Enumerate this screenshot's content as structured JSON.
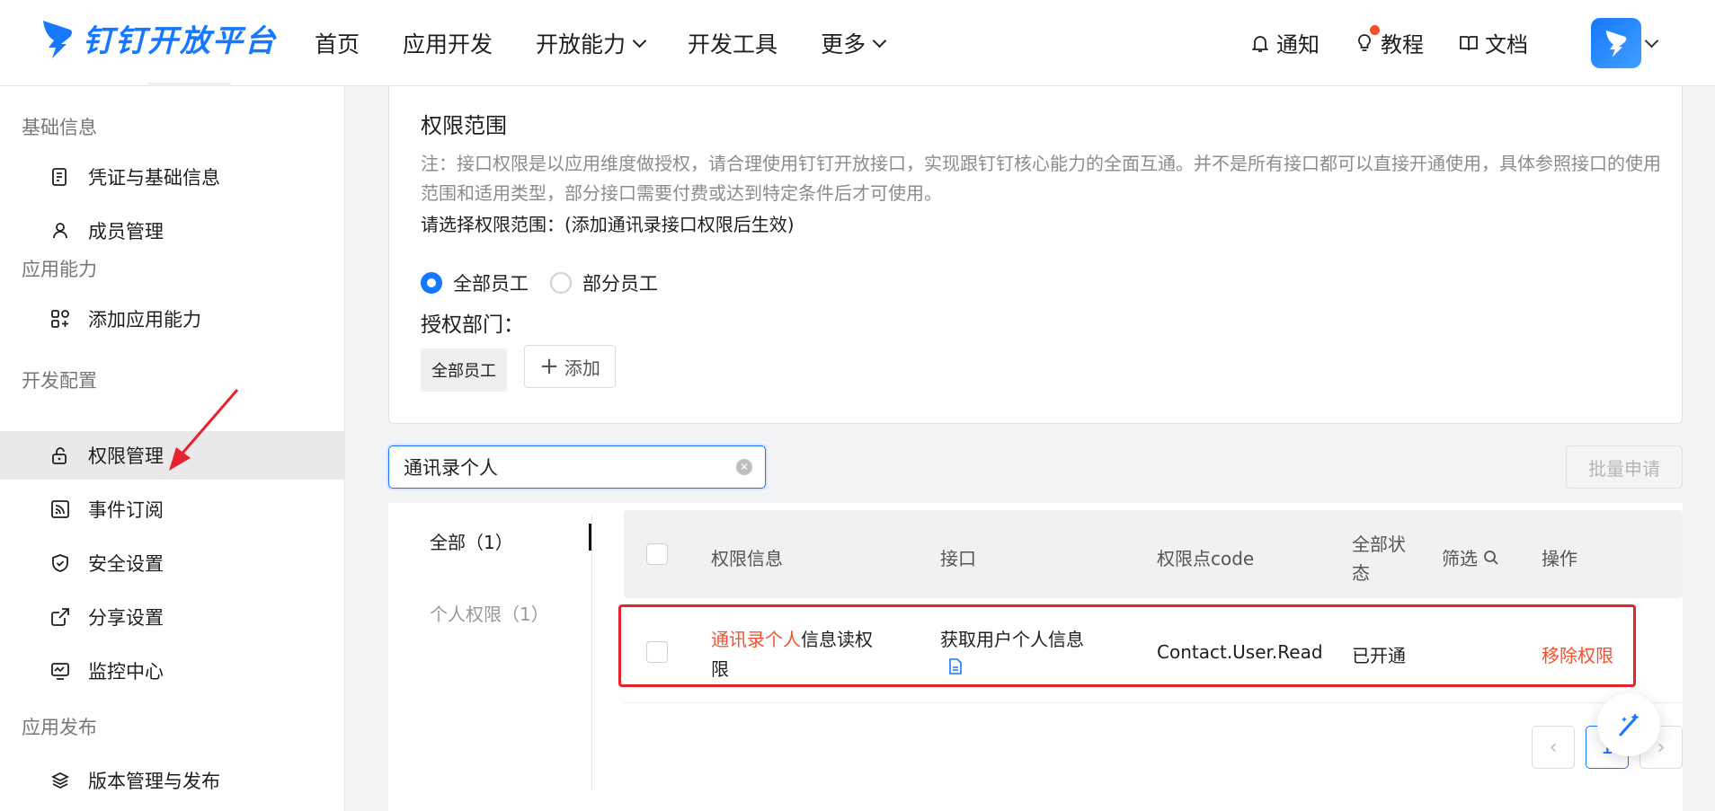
{
  "colors": {
    "accent": "#1677ff",
    "danger": "#f5502c",
    "highlight_box": "#e4232e"
  },
  "header": {
    "brand": "钉钉开放平台",
    "nav": [
      "首页",
      "应用开发",
      "开放能力",
      "开发工具",
      "更多"
    ],
    "right": {
      "notify": "通知",
      "tutorial": "教程",
      "docs": "文档"
    }
  },
  "sidebar": {
    "groups": [
      {
        "label": "基础信息",
        "items": [
          "凭证与基础信息",
          "成员管理"
        ]
      },
      {
        "label": "应用能力",
        "items": [
          "添加应用能力"
        ]
      },
      {
        "label": "开发配置",
        "items": [
          "权限管理",
          "事件订阅",
          "安全设置",
          "分享设置",
          "监控中心"
        ]
      },
      {
        "label": "应用发布",
        "items": [
          "版本管理与发布"
        ]
      }
    ],
    "active": "权限管理"
  },
  "scope": {
    "title": "权限范围",
    "note": "注：接口权限是以应用维度做授权，请合理使用钉钉开放接口，实现跟钉钉核心能力的全面互通。并不是所有接口都可以直接开通使用，具体参照接口的使用范围和适用类型，部分接口需要付费或达到特定条件后才可使用。",
    "prompt": "请选择权限范围：(添加通讯录接口权限后生效)",
    "radio_all": "全部员工",
    "radio_partial": "部分员工",
    "selected": "全部员工",
    "dept_label": "授权部门：",
    "dept_tag": "全部员工",
    "add_label": "添加"
  },
  "search": {
    "value": "通讯录个人"
  },
  "batch_apply": "批量申请",
  "filters": {
    "all": "全部（1）",
    "personal": "个人权限（1）"
  },
  "table": {
    "headers": {
      "info": "权限信息",
      "api": "接口",
      "code": "权限点code",
      "status": "全部状态",
      "filter": "筛选",
      "action": "操作"
    },
    "rows": [
      {
        "info_highlight": "通讯录个人",
        "info_rest": "信息读权限",
        "api": "获取用户个人信息",
        "code": "Contact.User.Read",
        "status": "已开通",
        "action": "移除权限"
      }
    ]
  },
  "pagination": {
    "current": "1"
  }
}
